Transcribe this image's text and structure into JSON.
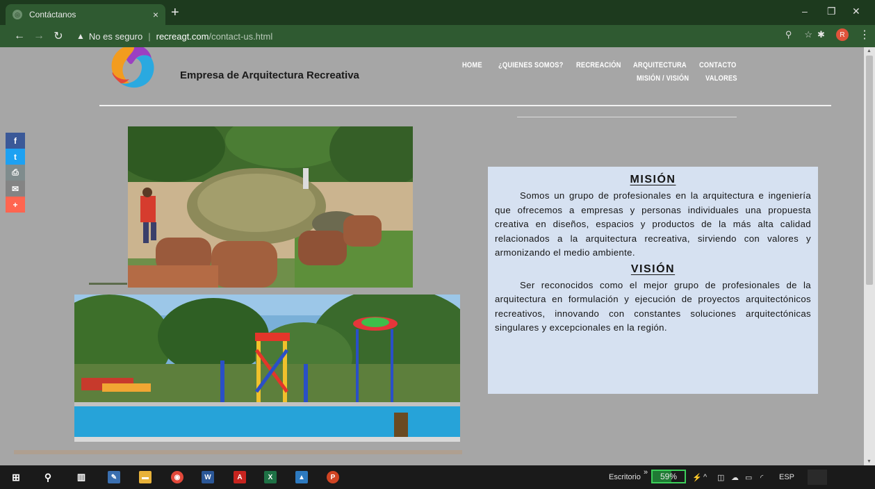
{
  "browser": {
    "tab_title": "Contáctanos",
    "tab_close": "×",
    "new_tab": "+",
    "security_label": "No es seguro",
    "url_host": "recreagt.com",
    "url_path": "/contact-us.html",
    "profile_initial": "R"
  },
  "site": {
    "company_name": "Empresa de Arquitectura Recreativa",
    "nav": {
      "home": "HOME",
      "quienes": "¿QUIENES SOMOS?",
      "recreacion": "RECREACIÓN",
      "arquitectura": "ARQUITECTURA",
      "contacto": "CONTACTO",
      "mision_vision": "MISIÓN / VISIÓN",
      "valores": "VALORES"
    },
    "share": {
      "facebook": "f",
      "twitter": "t",
      "print": "⎙",
      "email": "✉",
      "more": "+"
    },
    "mision": {
      "title": "MISIÓN",
      "text": "Somos un grupo de profesionales en la arquitectura e ingeniería que ofrecemos a empresas y personas individuales una propuesta creativa en diseños, espacios y productos de la más alta calidad relacionados a la arquitectura recreativa, sirviendo con valores y armonizando el medio ambiente."
    },
    "vision": {
      "title": "VISIÓN",
      "text": "Ser reconocidos como el mejor grupo de profesionales de la arquitectura en formulación y ejecución de proyectos arquitectónicos recreativos, innovando con constantes soluciones arquitectónicas singulares y excepcionales en la región."
    }
  },
  "taskbar": {
    "desktop_label": "Escritorio",
    "battery_level": 0.59,
    "battery_text": "59%",
    "language": "ESP"
  },
  "colors": {
    "page_bg": "#a6a6a6",
    "chrome_bg": "#2f5a31",
    "mv_box_bg": "#d6e1f1",
    "facebook": "#3b5998",
    "twitter": "#1da1f2",
    "print": "#7f8c8d",
    "email": "#848484",
    "more": "#ff6550"
  }
}
